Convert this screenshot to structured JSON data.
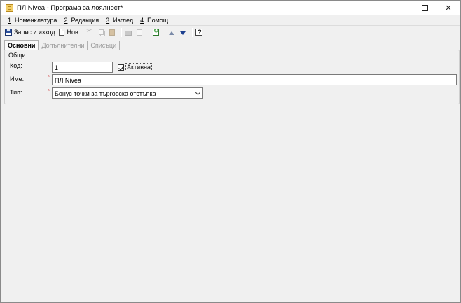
{
  "window": {
    "title": "ПЛ Nivea - Програма за лоялност*"
  },
  "menu": [
    {
      "key": "1",
      "label": ". Номенклатура"
    },
    {
      "key": "2",
      "label": ". Редакция"
    },
    {
      "key": "3",
      "label": ". Изглед"
    },
    {
      "key": "4",
      "label": ". Помощ"
    }
  ],
  "toolbar": {
    "save_exit_label": "Запис и изход",
    "new_label": "Нов"
  },
  "tabs": [
    {
      "label": "Основни",
      "active": true
    },
    {
      "label": "Допълнителни",
      "active": false
    },
    {
      "label": "Списъци",
      "active": false
    }
  ],
  "form": {
    "group_label": "Общи",
    "code_label": "Код:",
    "code_value": "1",
    "active_label": "Активна",
    "active_checked": true,
    "name_label": "Име:",
    "name_value": "ПЛ Nivea",
    "type_label": "Тип:",
    "type_value": "Бонус точки за търговска отстъпка",
    "required_marker": "*"
  }
}
